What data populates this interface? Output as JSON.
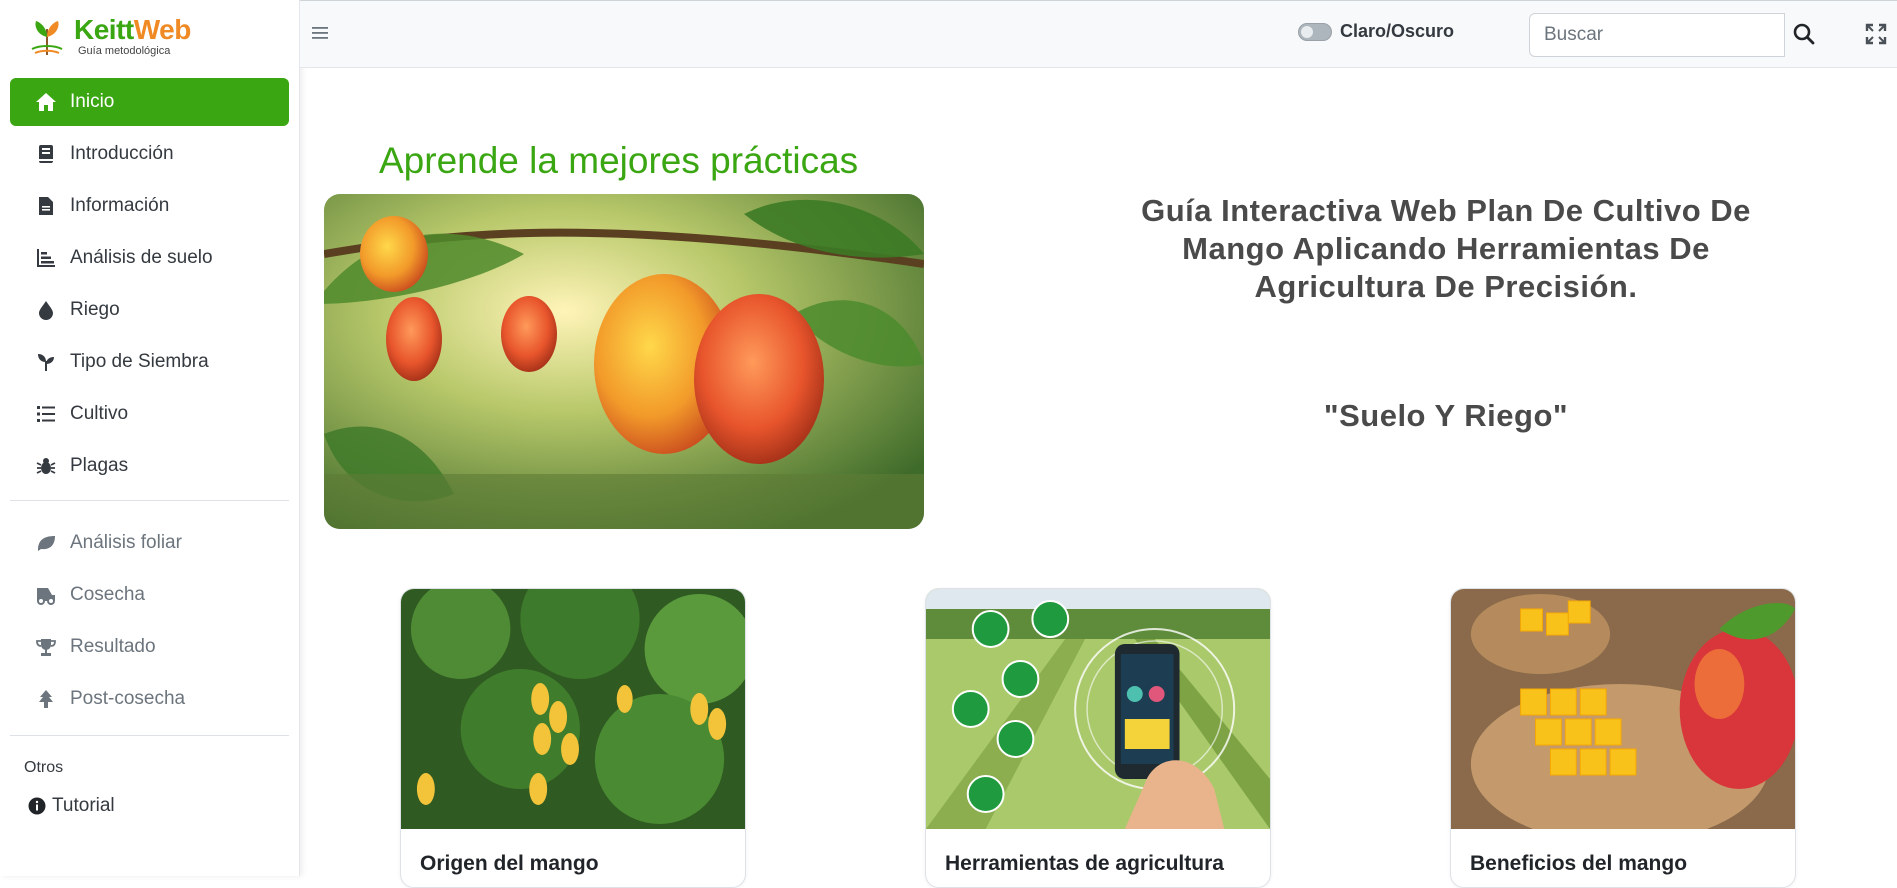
{
  "brand": {
    "name_part1": "Keitt",
    "name_part2": "Web",
    "subtitle": "Guía metodológica"
  },
  "sidebar": {
    "primary_items": [
      {
        "label": "Inicio",
        "icon": "home-icon",
        "active": true
      },
      {
        "label": "Introducción",
        "icon": "book-icon"
      },
      {
        "label": "Información",
        "icon": "file-icon"
      },
      {
        "label": "Análisis de suelo",
        "icon": "chart-bar-icon"
      },
      {
        "label": "Riego",
        "icon": "droplet-icon"
      },
      {
        "label": "Tipo de Siembra",
        "icon": "seedling-icon"
      },
      {
        "label": "Cultivo",
        "icon": "list-icon"
      },
      {
        "label": "Plagas",
        "icon": "bug-icon"
      }
    ],
    "secondary_items": [
      {
        "label": "Análisis foliar",
        "icon": "leaf-icon"
      },
      {
        "label": "Cosecha",
        "icon": "tractor-icon"
      },
      {
        "label": "Resultado",
        "icon": "trophy-icon"
      },
      {
        "label": "Post-cosecha",
        "icon": "tree-icon"
      }
    ],
    "others_label": "Otros",
    "other_items": [
      {
        "label": "Tutorial",
        "icon": "info-circle-icon"
      }
    ]
  },
  "topbar": {
    "theme_toggle_label": "Claro/Oscuro",
    "search_placeholder": "Buscar"
  },
  "main": {
    "hero_title": "Aprende la mejores prácticas",
    "guide_title": "Guía Interactiva Web Plan De Cultivo De Mango Aplicando Herramientas De Agricultura De Precisión.",
    "guide_subtitle": "\"Suelo Y Riego\"",
    "cards": [
      {
        "title": "Origen del mango"
      },
      {
        "title": "Herramientas de agricultura"
      },
      {
        "title": "Beneficios del mango"
      }
    ]
  },
  "colors": {
    "accent": "#3aa612",
    "brand_orange": "#f08a24"
  }
}
